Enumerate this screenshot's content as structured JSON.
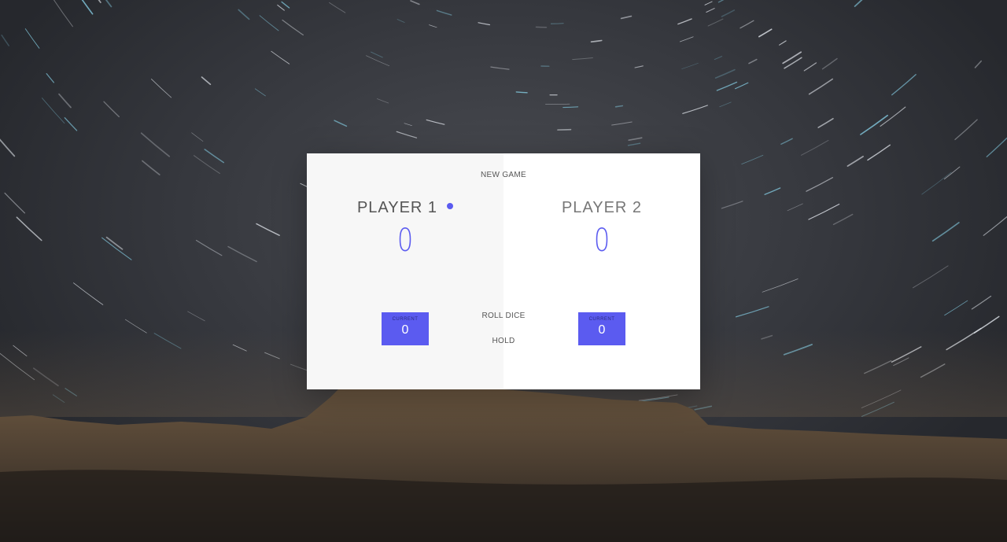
{
  "buttons": {
    "new_game": "NEW GAME",
    "roll_dice": "ROLL DICE",
    "hold": "HOLD"
  },
  "players": [
    {
      "name": "PLAYER 1",
      "score": "0",
      "current_label": "CURRENT",
      "current_score": "0",
      "active": true
    },
    {
      "name": "PLAYER 2",
      "score": "0",
      "current_label": "CURRENT",
      "current_score": "0",
      "active": false
    }
  ],
  "colors": {
    "accent": "#5b5bf0",
    "panel_active": "#f7f7f7",
    "panel_inactive": "#ffffff"
  },
  "icons": {
    "active_indicator": "active-dot-icon"
  }
}
